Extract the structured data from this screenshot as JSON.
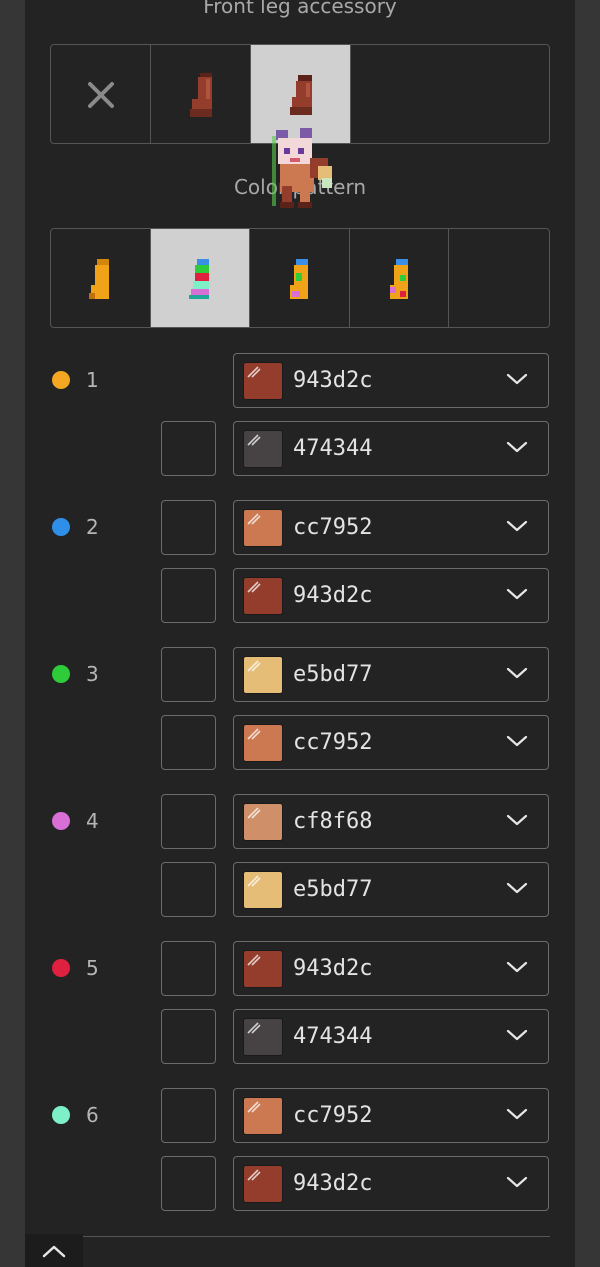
{
  "section_front_leg": {
    "title": "Front leg accessory"
  },
  "section_color_pattern": {
    "title": "Color pattern"
  },
  "accessory_tiles": [
    {
      "name": "none",
      "icon": "x-icon",
      "selected": false
    },
    {
      "name": "sock-dark",
      "icon": "leg-accessory-icon",
      "selected": false
    },
    {
      "name": "sock-short",
      "icon": "leg-accessory-icon",
      "selected": true
    }
  ],
  "pattern_tiles": [
    {
      "name": "pattern-1",
      "selected": false
    },
    {
      "name": "pattern-2",
      "selected": true
    },
    {
      "name": "pattern-3",
      "selected": false
    },
    {
      "name": "pattern-4",
      "selected": false
    }
  ],
  "color_groups": [
    {
      "number": "1",
      "dot_color": "#f5a623",
      "rows": [
        {
          "hex": "943d2c",
          "swatch": "#943d2c",
          "has_checkbox": false
        },
        {
          "hex": "474344",
          "swatch": "#474344",
          "has_checkbox": true
        }
      ]
    },
    {
      "number": "2",
      "dot_color": "#2f8fe8",
      "rows": [
        {
          "hex": "cc7952",
          "swatch": "#cc7952",
          "has_checkbox": true
        },
        {
          "hex": "943d2c",
          "swatch": "#943d2c",
          "has_checkbox": true
        }
      ]
    },
    {
      "number": "3",
      "dot_color": "#2ecb3a",
      "rows": [
        {
          "hex": "e5bd77",
          "swatch": "#e5bd77",
          "has_checkbox": true
        },
        {
          "hex": "cc7952",
          "swatch": "#cc7952",
          "has_checkbox": true
        }
      ]
    },
    {
      "number": "4",
      "dot_color": "#d86fd6",
      "rows": [
        {
          "hex": "cf8f68",
          "swatch": "#cf8f68",
          "has_checkbox": true
        },
        {
          "hex": "e5bd77",
          "swatch": "#e5bd77",
          "has_checkbox": true
        }
      ]
    },
    {
      "number": "5",
      "dot_color": "#e0203f",
      "rows": [
        {
          "hex": "943d2c",
          "swatch": "#943d2c",
          "has_checkbox": true
        },
        {
          "hex": "474344",
          "swatch": "#474344",
          "has_checkbox": true
        }
      ]
    },
    {
      "number": "6",
      "dot_color": "#7ef0c8",
      "rows": [
        {
          "hex": "cc7952",
          "swatch": "#cc7952",
          "has_checkbox": true
        },
        {
          "hex": "943d2c",
          "swatch": "#943d2c",
          "has_checkbox": true
        }
      ]
    }
  ],
  "footer": {
    "collapse_icon": "chevron-up-icon"
  }
}
